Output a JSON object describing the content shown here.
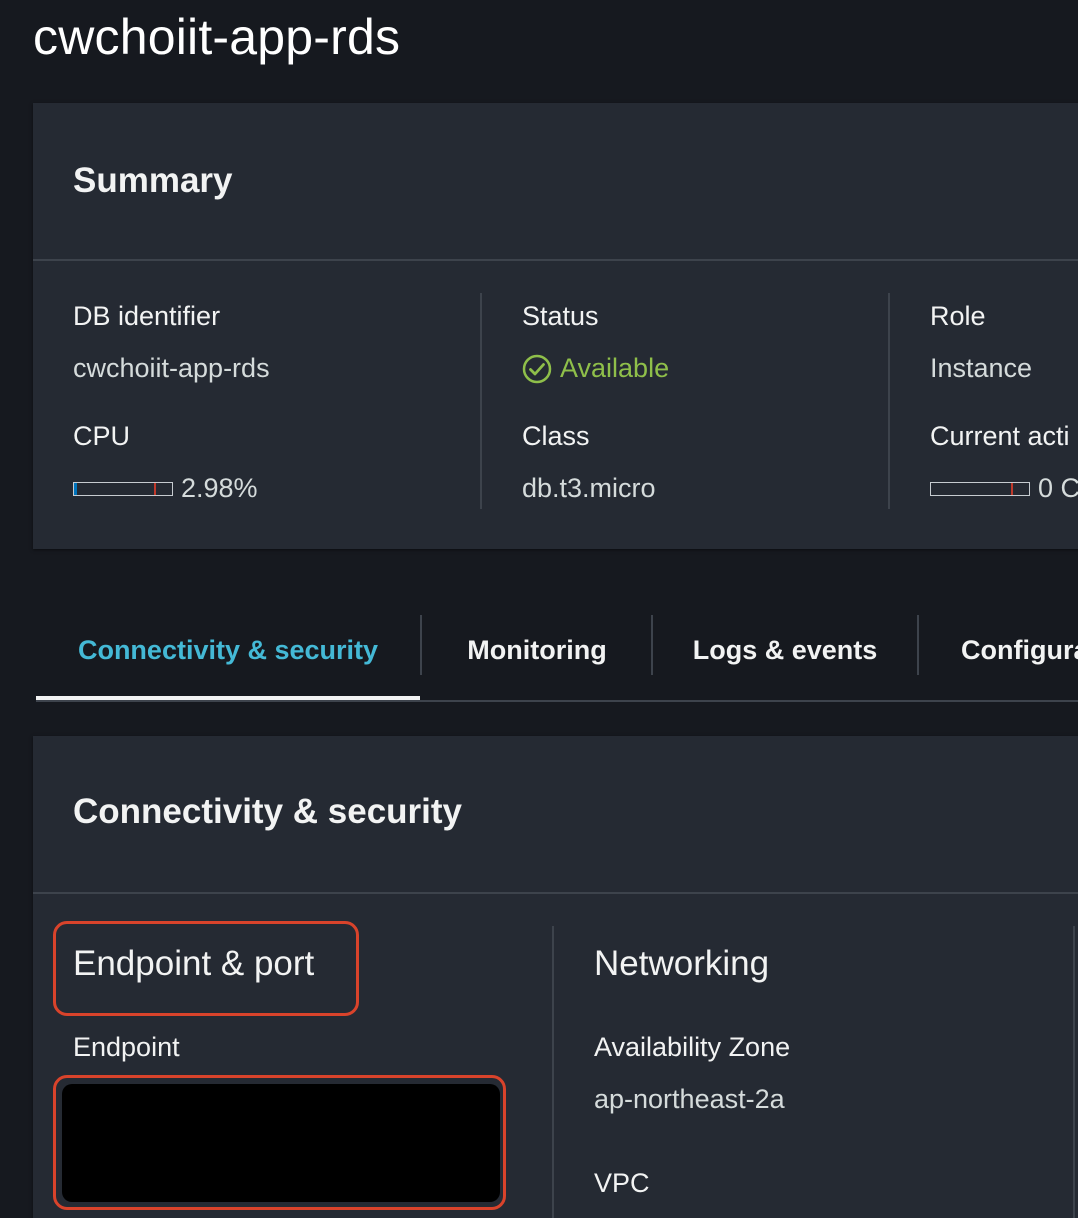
{
  "page": {
    "title": "cwchoiit-app-rds"
  },
  "summary": {
    "heading": "Summary",
    "db_identifier": {
      "label": "DB identifier",
      "value": "cwchoiit-app-rds"
    },
    "cpu": {
      "label": "CPU",
      "value": "2.98%",
      "fill_fraction": 0.0298
    },
    "status": {
      "label": "Status",
      "value": "Available",
      "status_color": "#8fbf4a"
    },
    "class": {
      "label": "Class",
      "value": "db.t3.micro"
    },
    "role": {
      "label": "Role",
      "value": "Instance"
    },
    "current_activity": {
      "label": "Current acti",
      "value": "0 C"
    }
  },
  "tabs": [
    {
      "label": "Connectivity & security",
      "active": true
    },
    {
      "label": "Monitoring",
      "active": false
    },
    {
      "label": "Logs & events",
      "active": false
    },
    {
      "label": "Configura",
      "active": false
    }
  ],
  "connectivity": {
    "heading": "Connectivity & security",
    "endpoint_port": {
      "heading": "Endpoint & port",
      "endpoint_label": "Endpoint"
    },
    "networking": {
      "heading": "Networking",
      "availability_zone_label": "Availability Zone",
      "availability_zone_value": "ap-northeast-2a",
      "vpc_label": "VPC"
    }
  },
  "colors": {
    "background": "#16191f",
    "panel": "#252a33",
    "active_tab": "#44b9d6",
    "highlight": "#d9432b",
    "status_available": "#8fbf4a"
  }
}
